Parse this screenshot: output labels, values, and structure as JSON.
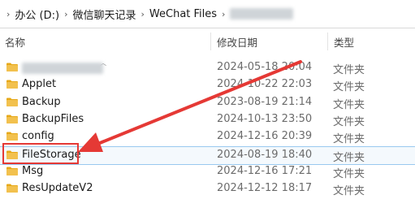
{
  "breadcrumb": {
    "items": [
      "办公 (D:)",
      "微信聊天记录",
      "WeChat Files"
    ],
    "separator": "›"
  },
  "columns": {
    "name": "名称",
    "date": "修改日期",
    "type": "类型"
  },
  "rows": [
    {
      "name": "",
      "date": "2024-05-18 20:04",
      "type": "文件夹",
      "blurred": true
    },
    {
      "name": "Applet",
      "date": "2024-10-22 22:03",
      "type": "文件夹"
    },
    {
      "name": "Backup",
      "date": "2023-08-19 21:14",
      "type": "文件夹"
    },
    {
      "name": "BackupFiles",
      "date": "2024-10-13 23:50",
      "type": "文件夹"
    },
    {
      "name": "config",
      "date": "2024-12-16 20:39",
      "type": "文件夹"
    },
    {
      "name": "FileStorage",
      "date": "2024-08-19 18:40",
      "type": "文件夹",
      "selected": true
    },
    {
      "name": "Msg",
      "date": "2024-12-16 17:21",
      "type": "文件夹"
    },
    {
      "name": "ResUpdateV2",
      "date": "2024-12-12 18:17",
      "type": "文件夹"
    }
  ],
  "colors": {
    "annotation": "#e53935",
    "folder": "#f2c14e",
    "selection_border": "#99c9ef"
  },
  "icons": {
    "folder": "folder-icon",
    "separator": "chevron-right-icon",
    "sort": "sort-ascending-icon"
  }
}
